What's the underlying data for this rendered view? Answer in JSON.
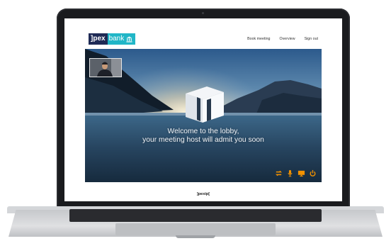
{
  "header": {
    "logo_left": "]pex",
    "logo_right": "bank",
    "nav": [
      "Book meeting",
      "Overview",
      "Sign out"
    ]
  },
  "lobby": {
    "welcome_line1": "Welcome to the lobby,",
    "welcome_line2": "your meeting host will admit you soon"
  },
  "controls": [
    "swap-camera-icon",
    "microphone-icon",
    "screen-share-icon",
    "power-icon"
  ],
  "footer": {
    "brand": "]pexip["
  },
  "colors": {
    "brand_navy": "#1e2a55",
    "brand_teal": "#21b6c7",
    "control_orange": "#f39200"
  }
}
